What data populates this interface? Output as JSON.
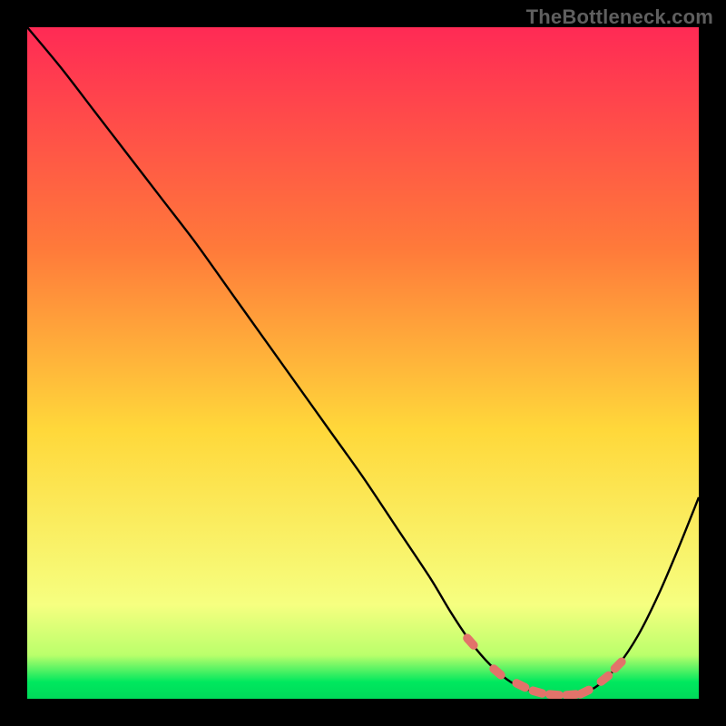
{
  "attribution": "TheBottleneck.com",
  "colors": {
    "bg": "#000000",
    "attribution_text": "#5f5f5f",
    "curve": "#000000",
    "marker_fill": "#e2736a",
    "marker_stroke": "#b23e3e",
    "gradient": {
      "top": "#ff2a55",
      "upper_mid": "#ff7a3a",
      "mid": "#ffd83a",
      "lower_mid": "#f6ff80",
      "green_band_top": "#baff6b",
      "green_band_bot": "#00e85e",
      "bottom": "#00d95a"
    }
  },
  "chart_data": {
    "type": "line",
    "title": "",
    "xlabel": "",
    "ylabel": "",
    "xlim": [
      0,
      100
    ],
    "ylim": [
      0,
      100
    ],
    "grid": false,
    "series": [
      {
        "name": "bottleneck-curve",
        "x": [
          0,
          5,
          10,
          15,
          20,
          25,
          30,
          35,
          40,
          45,
          50,
          55,
          60,
          63,
          66,
          69,
          72,
          75,
          78,
          81,
          83,
          85,
          88,
          91,
          94,
          97,
          100
        ],
        "y": [
          100,
          94,
          87.5,
          81,
          74.5,
          68,
          61,
          54,
          47,
          40,
          33,
          25.5,
          18,
          13,
          8.5,
          5,
          2.5,
          1.2,
          0.6,
          0.6,
          1.0,
          2.0,
          5.0,
          9.5,
          15.5,
          22.5,
          30
        ]
      }
    ],
    "markers": {
      "name": "optimal-region",
      "shape": "rounded-dash",
      "x": [
        66,
        70,
        73.5,
        76,
        78.5,
        81,
        83,
        86,
        88
      ],
      "y": [
        8.5,
        4.0,
        2.0,
        1.0,
        0.6,
        0.6,
        1.0,
        3.0,
        5.0
      ]
    },
    "background_gradient_stops": [
      {
        "pos": 0.0,
        "color_key": "top"
      },
      {
        "pos": 0.33,
        "color_key": "upper_mid"
      },
      {
        "pos": 0.6,
        "color_key": "mid"
      },
      {
        "pos": 0.86,
        "color_key": "lower_mid"
      },
      {
        "pos": 0.935,
        "color_key": "green_band_top"
      },
      {
        "pos": 0.975,
        "color_key": "green_band_bot"
      },
      {
        "pos": 1.0,
        "color_key": "bottom"
      }
    ]
  }
}
